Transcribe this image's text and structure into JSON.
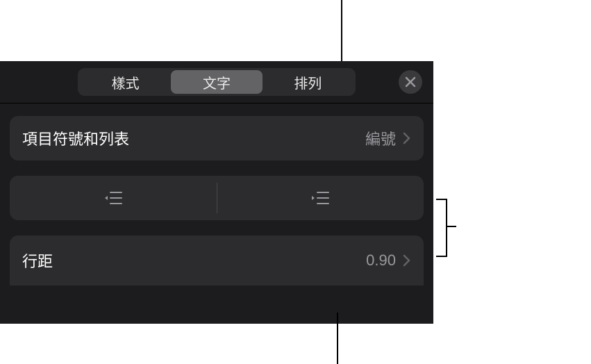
{
  "tabs": {
    "style": "樣式",
    "text": "文字",
    "arrange": "排列"
  },
  "bullets": {
    "label": "項目符號和列表",
    "value": "編號"
  },
  "lineSpacing": {
    "label": "行距",
    "value": "0.90"
  }
}
